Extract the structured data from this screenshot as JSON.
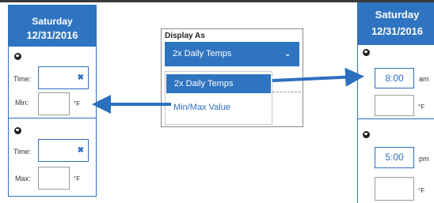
{
  "left_panel": {
    "day": "Saturday",
    "date": "12/31/2016",
    "time_label_1": "Time:",
    "min_label": "Min:",
    "unit_1": "°F",
    "clear_1": "✖",
    "time_label_2": "Time:",
    "max_label": "Max:",
    "unit_2": "°F",
    "clear_2": "✖"
  },
  "dropdown": {
    "label": "Display As",
    "selected": "2x Daily Temps",
    "chevron": "⌄",
    "options": [
      "2x Daily Temps",
      "Min/Max Value"
    ]
  },
  "right_panel": {
    "day": "Saturday",
    "date": "12/31/2016",
    "time_1": "8:00",
    "period_1": "am",
    "unit_1": "°F",
    "time_2": "5:00",
    "period_2": "pm",
    "unit_2": "°F"
  },
  "colors": {
    "accent_blue": "#2f74c0",
    "border_blue": "#2c6fbf"
  },
  "icons": [
    "thermometer-fill-icon",
    "clear-x-icon",
    "chevron-down-icon",
    "arrow-icon"
  ]
}
